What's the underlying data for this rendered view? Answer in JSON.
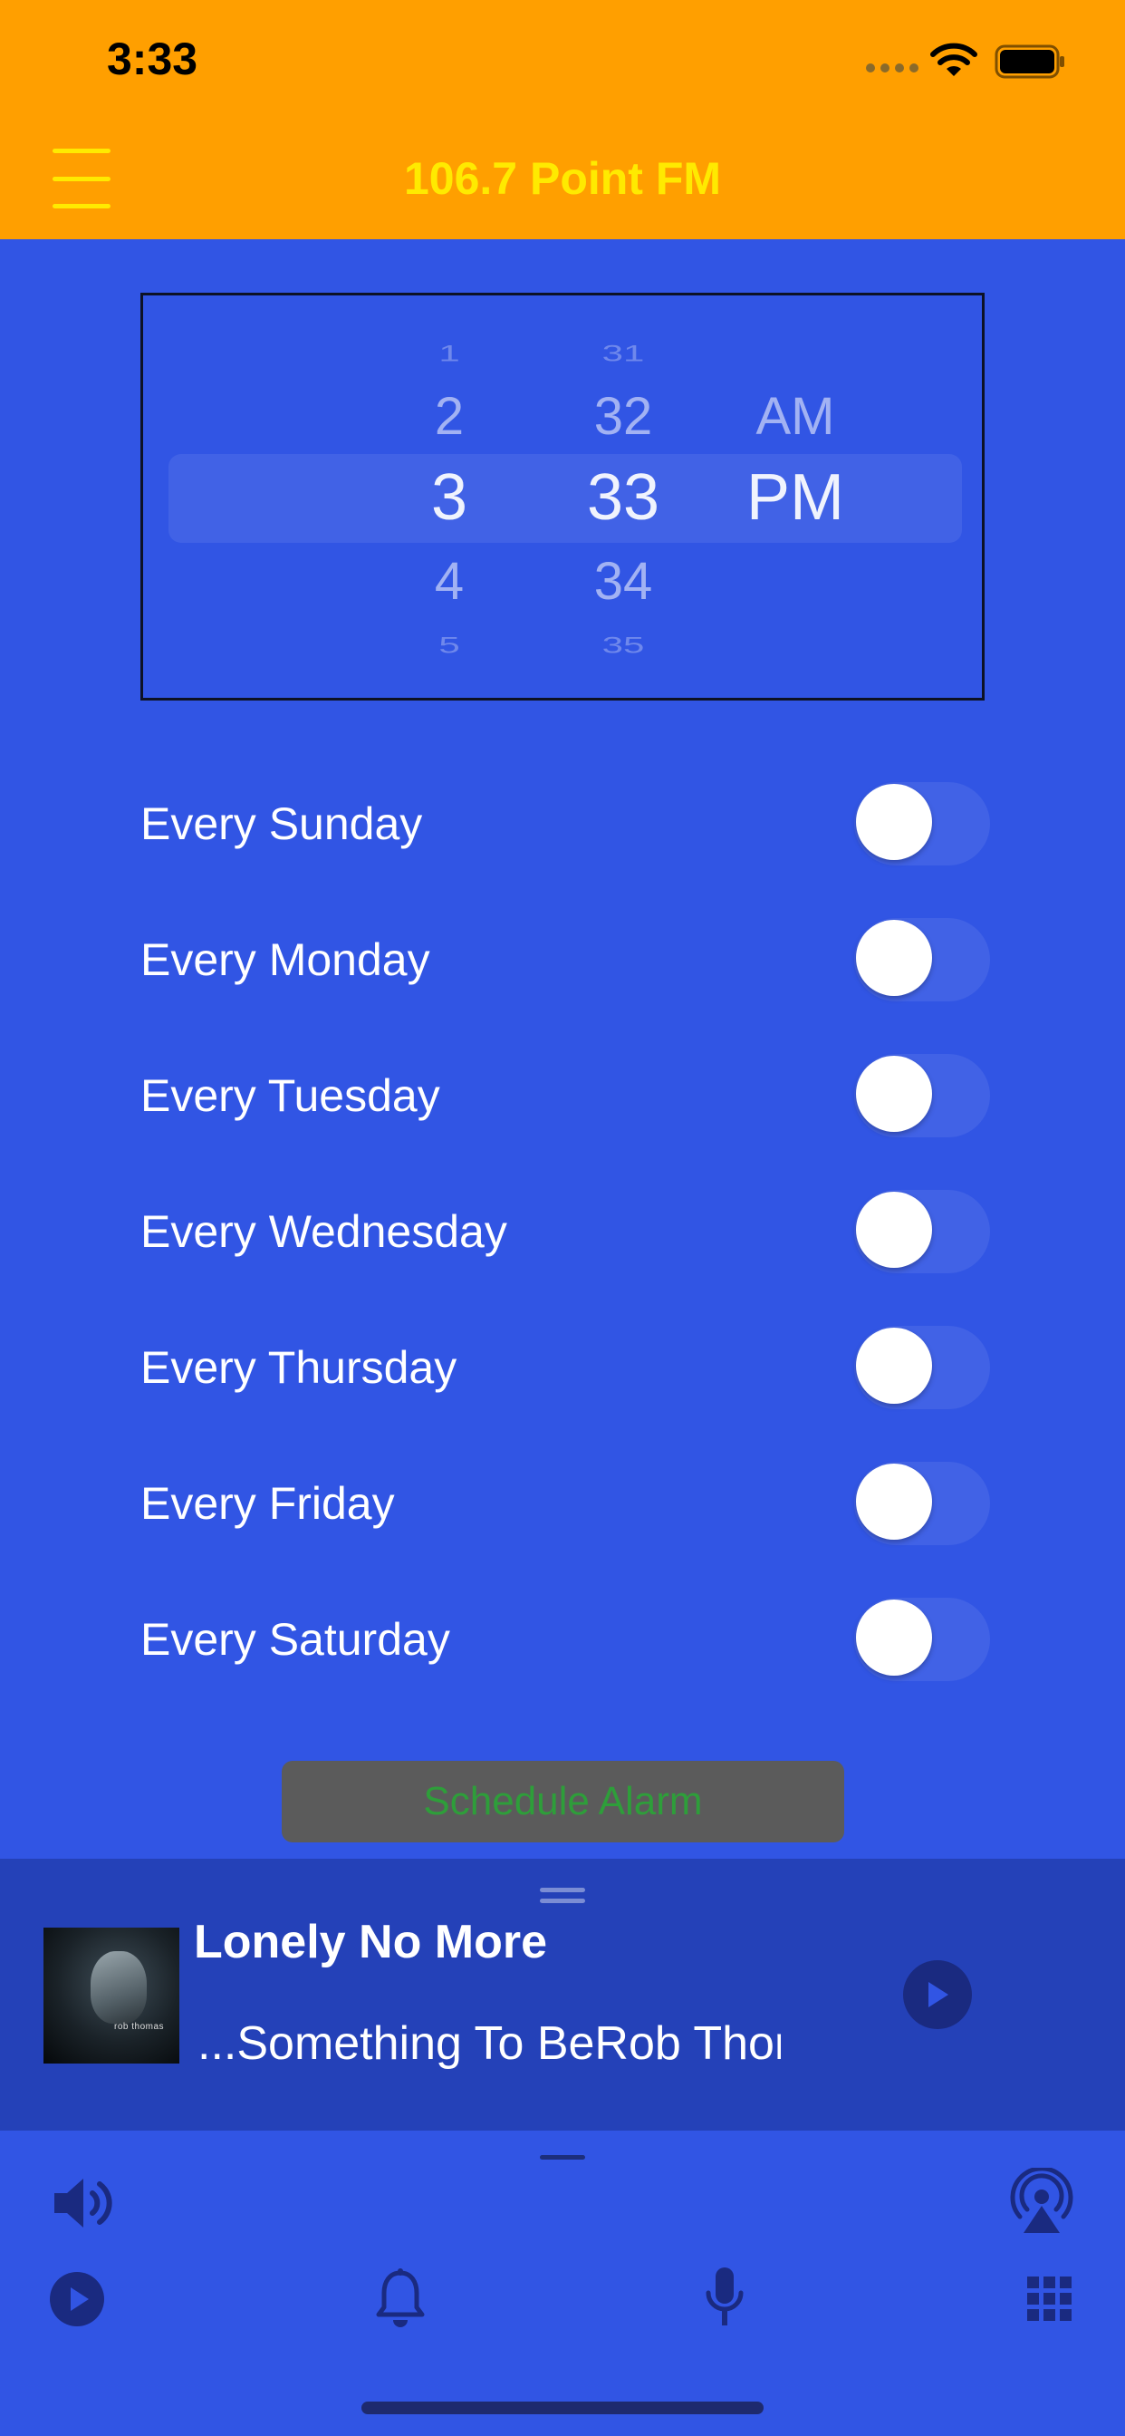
{
  "status_bar": {
    "time": "3:33"
  },
  "header": {
    "title": "106.7 Point FM"
  },
  "picker": {
    "hours": {
      "far_above": "1",
      "above": "2",
      "selected": "3",
      "below": "4",
      "far_below": "5"
    },
    "minutes": {
      "far_above": "31",
      "above": "32",
      "selected": "33",
      "below": "34",
      "far_below": "35"
    },
    "period": {
      "above": "AM",
      "selected": "PM"
    }
  },
  "days": [
    {
      "label": "Every Sunday",
      "on": false
    },
    {
      "label": "Every Monday",
      "on": false
    },
    {
      "label": "Every Tuesday",
      "on": false
    },
    {
      "label": "Every Wednesday",
      "on": false
    },
    {
      "label": "Every Thursday",
      "on": false
    },
    {
      "label": "Every Friday",
      "on": false
    },
    {
      "label": "Every Saturday",
      "on": false
    }
  ],
  "schedule_button": {
    "label": "Schedule Alarm"
  },
  "now_playing": {
    "title": "Lonely No More",
    "subtitle": "...Something To BeRob Thomas",
    "album_caption": "rob thomas"
  },
  "colors": {
    "header_bg": "#FF9F00",
    "title_color": "#FFEA00",
    "main_bg": "#3155E4",
    "now_playing_bg": "#2441B8",
    "icon_color": "#1A2A80",
    "button_text": "#2E9E3A"
  },
  "icons": {
    "menu": "hamburger-menu-icon",
    "volume": "speaker-icon",
    "airplay": "airplay-icon",
    "play": "play-icon",
    "alarm": "bell-icon",
    "mic": "microphone-icon",
    "grid": "grid-icon"
  }
}
